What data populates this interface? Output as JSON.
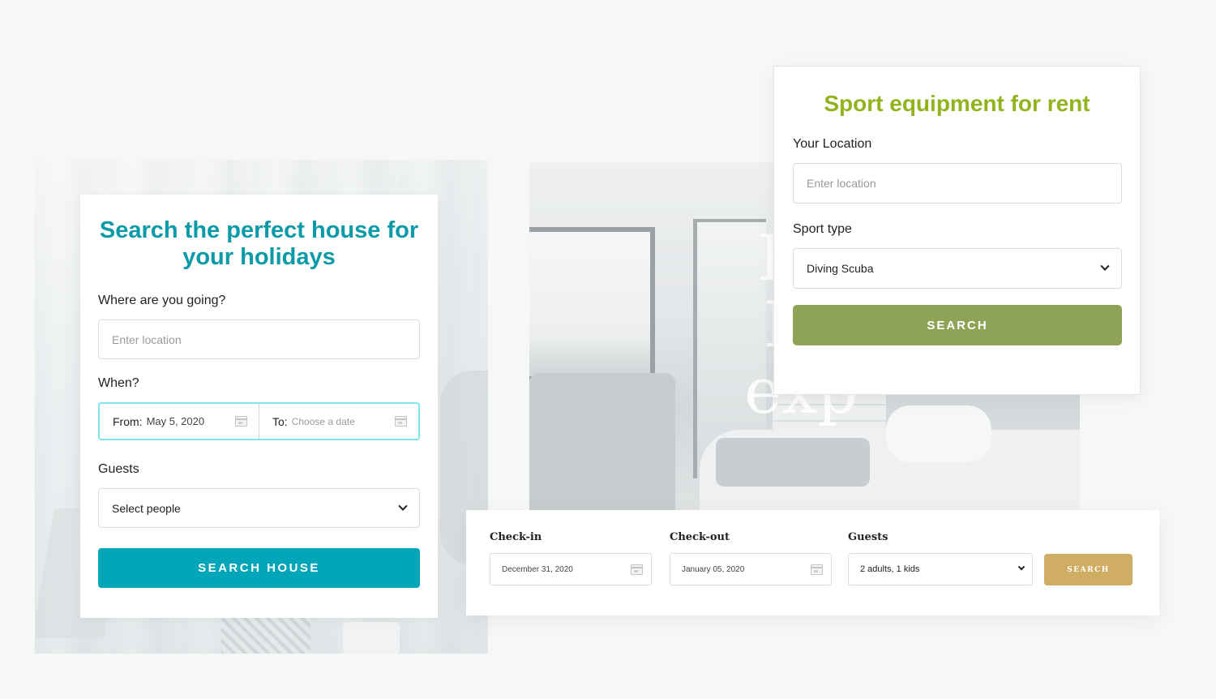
{
  "house_search": {
    "title": "Search the perfect house for your holidays",
    "location_label": "Where are you going?",
    "location_placeholder": "Enter location",
    "when_label": "When?",
    "from_label": "From:",
    "from_value": "May 5, 2020",
    "to_label": "To:",
    "to_placeholder": "Choose a date",
    "guests_label": "Guests",
    "guests_value": "Select people",
    "search_button": "SEARCH HOUSE",
    "accent_color": "#0a9aa8",
    "button_color": "#03a6b8"
  },
  "hero": {
    "text_fragments": [
      "En",
      "Hi",
      "exp"
    ]
  },
  "sport_rental": {
    "title": "Sport equipment for rent",
    "location_label": "Your Location",
    "location_placeholder": "Enter location",
    "sport_label": "Sport type",
    "sport_value": "Diving Scuba",
    "search_button": "SEARCH",
    "accent_color": "#92b21e",
    "button_color": "#8fa356"
  },
  "booking_bar": {
    "checkin_label": "Check-in",
    "checkin_value": "December 31, 2020",
    "checkout_label": "Check-out",
    "checkout_value": "January 05, 2020",
    "guests_label": "Guests",
    "guests_value": "2 adults, 1 kids",
    "search_button": "SEARCH",
    "button_color": "#cfad62"
  }
}
